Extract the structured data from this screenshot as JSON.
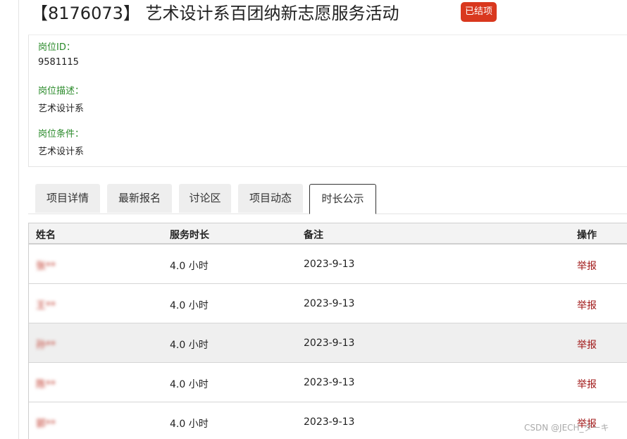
{
  "project": {
    "title": "【8176073】 艺术设计系百团纳新志愿服务活动",
    "status": "已结项"
  },
  "info": {
    "post_id_label": "岗位ID：",
    "post_id_value": "9581115",
    "post_desc_label": "岗位描述：",
    "post_desc_value": "艺术设计系",
    "post_cond_label": "岗位条件：",
    "post_cond_value": "艺术设计系"
  },
  "tabs": [
    {
      "label": "项目详情"
    },
    {
      "label": "最新报名"
    },
    {
      "label": "讨论区"
    },
    {
      "label": "项目动态"
    },
    {
      "label": "时长公示",
      "active": true
    }
  ],
  "table": {
    "headers": {
      "name": "姓名",
      "hours": "服务时长",
      "note": "备注",
      "action": "操作"
    },
    "rows": [
      {
        "name": "张**",
        "hours": "4.0 小时",
        "note": "2023-9-13",
        "action": "举报"
      },
      {
        "name": "王**",
        "hours": "4.0 小时",
        "note": "2023-9-13",
        "action": "举报"
      },
      {
        "name": "孙**",
        "hours": "4.0 小时",
        "note": "2023-9-13",
        "action": "举报"
      },
      {
        "name": "陈**",
        "hours": "4.0 小时",
        "note": "2023-9-13",
        "action": "举报"
      },
      {
        "name": "郭**",
        "hours": "4.0 小时",
        "note": "2023-9-13",
        "action": "举报"
      }
    ]
  },
  "watermark": "CSDN @JECH_ターキ"
}
